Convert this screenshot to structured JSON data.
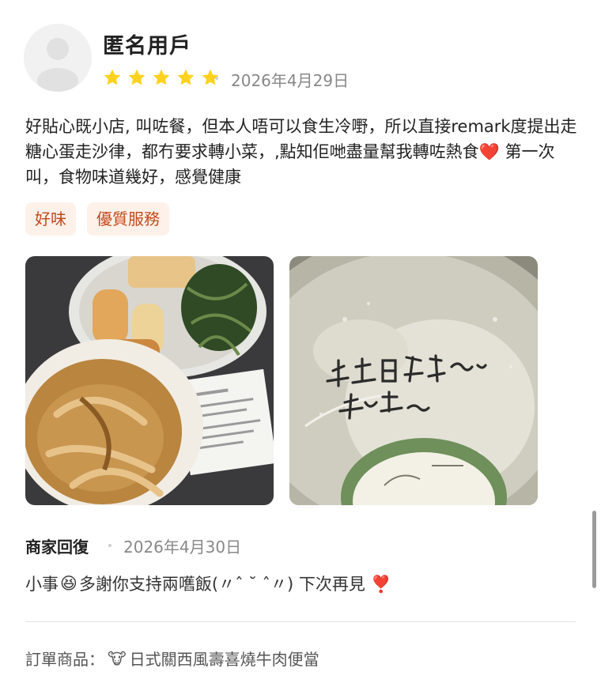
{
  "review": {
    "username": "匿名用戶",
    "rating": 5,
    "date": "2026年4月29日",
    "text": "好貼心既小店, 叫咗餐，但本人唔可以食生冷嘢，所以直接remark度提出走糖心蛋走沙律，都冇要求轉小菜，,點知佢哋盡量幫我轉咗熱食❤️ 第一次叫，食物味道幾好，感覺健康",
    "tags": [
      "好味",
      "優質服務"
    ],
    "photo_note": "盡量幫你轉ぶ熱食~"
  },
  "merchant_reply": {
    "title": "商家回復",
    "date": "2026年4月30日",
    "text_before_emoji": "小事",
    "emoji": "😆",
    "text_after_emoji": "多謝你支持兩嚿飯(〃ˆ ˘ ˆ〃) 下次再見 ❣️"
  },
  "order": {
    "label": "訂單商品：",
    "item_emoji": "🐮",
    "item": "日式關西風壽喜燒牛肉便當"
  },
  "colors": {
    "star": "#ffd21f",
    "tag_bg": "#fdf1ea",
    "tag_text": "#c24a1c"
  }
}
